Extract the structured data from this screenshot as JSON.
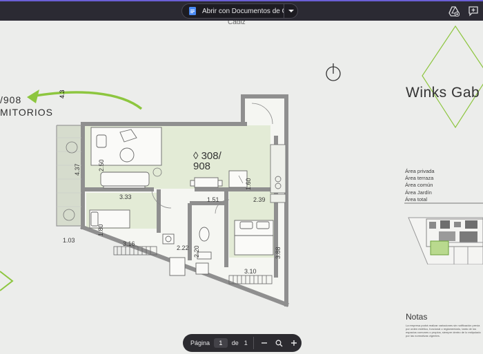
{
  "toolbar": {
    "open_with_label": "Abrir con Documentos de Go...",
    "docs_icon": "google-docs-icon",
    "dropdown_icon": "chevron-down-icon",
    "add_to_drive_icon": "add-to-drive-icon",
    "add_comment_icon": "add-comment-icon"
  },
  "document": {
    "cut_top_label": "Cadiz",
    "side_label_1": "/908",
    "side_label_2": "MITORIOS",
    "title": "Winks Gab",
    "unit_label_1": "◊ 308/",
    "unit_label_2": "908",
    "dims": [
      "4.37",
      "2.50",
      "3.33",
      "1.51",
      "1.60",
      "2.39",
      "1.80",
      "3.16",
      "2.22",
      "2.20",
      "3.10",
      "3.88",
      "1.03"
    ],
    "legend": [
      "Área privada",
      "Área terraza",
      "Área común",
      "Área Jardín",
      "Área total"
    ],
    "notes_title": "Notas",
    "notes_text": "La empresa podrá realizar variaciones sin notificación previa por orden estético, funcional o reglamentario, tanto de los espacios comunes o propios, siempre dentro de lo estipulado por las normativas vigentes."
  },
  "pager": {
    "page_label": "Página",
    "current_page": "1",
    "of_label": "de",
    "total_pages": "1",
    "zoom_out_icon": "minus-icon",
    "zoom_icon": "magnifier-icon",
    "zoom_in_icon": "plus-icon"
  },
  "colors": {
    "accent_green": "#8dc63f",
    "toolbar_bg": "#2b2a33",
    "room_fill": "#e3ebd6",
    "wall": "#a0a0a0"
  }
}
